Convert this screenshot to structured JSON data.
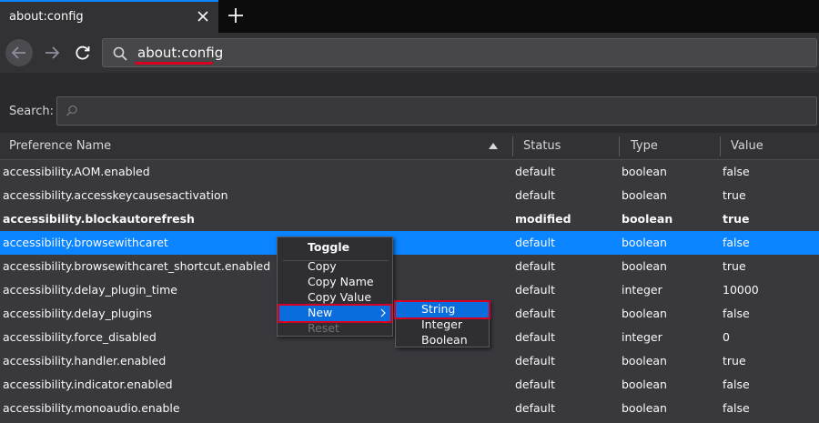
{
  "tab": {
    "title": "about:config"
  },
  "urlbar": {
    "value": "about:config"
  },
  "search": {
    "label": "Search:",
    "placeholder": ""
  },
  "columns": [
    "Preference Name",
    "Status",
    "Type",
    "Value"
  ],
  "rows": [
    {
      "name": "accessibility.AOM.enabled",
      "status": "default",
      "type": "boolean",
      "value": "false"
    },
    {
      "name": "accessibility.accesskeycausesactivation",
      "status": "default",
      "type": "boolean",
      "value": "true"
    },
    {
      "name": "accessibility.blockautorefresh",
      "status": "modified",
      "type": "boolean",
      "value": "true"
    },
    {
      "name": "accessibility.browsewithcaret",
      "status": "default",
      "type": "boolean",
      "value": "false"
    },
    {
      "name": "accessibility.browsewithcaret_shortcut.enabled",
      "status": "default",
      "type": "boolean",
      "value": "true"
    },
    {
      "name": "accessibility.delay_plugin_time",
      "status": "default",
      "type": "integer",
      "value": "10000"
    },
    {
      "name": "accessibility.delay_plugins",
      "status": "default",
      "type": "boolean",
      "value": "false"
    },
    {
      "name": "accessibility.force_disabled",
      "status": "default",
      "type": "integer",
      "value": "0"
    },
    {
      "name": "accessibility.handler.enabled",
      "status": "default",
      "type": "boolean",
      "value": "true"
    },
    {
      "name": "accessibility.indicator.enabled",
      "status": "default",
      "type": "boolean",
      "value": "false"
    },
    {
      "name": "accessibility.monoaudio.enable",
      "status": "default",
      "type": "boolean",
      "value": "false"
    }
  ],
  "selected_row": 3,
  "context_menu": {
    "items": [
      "Toggle",
      "Copy",
      "Copy Name",
      "Copy Value",
      "New",
      "Reset"
    ]
  },
  "submenu": {
    "items": [
      "String",
      "Integer",
      "Boolean"
    ]
  },
  "colors": {
    "accent": "#0a84ff",
    "highlight_border": "#d70022",
    "background": "#38383d"
  }
}
